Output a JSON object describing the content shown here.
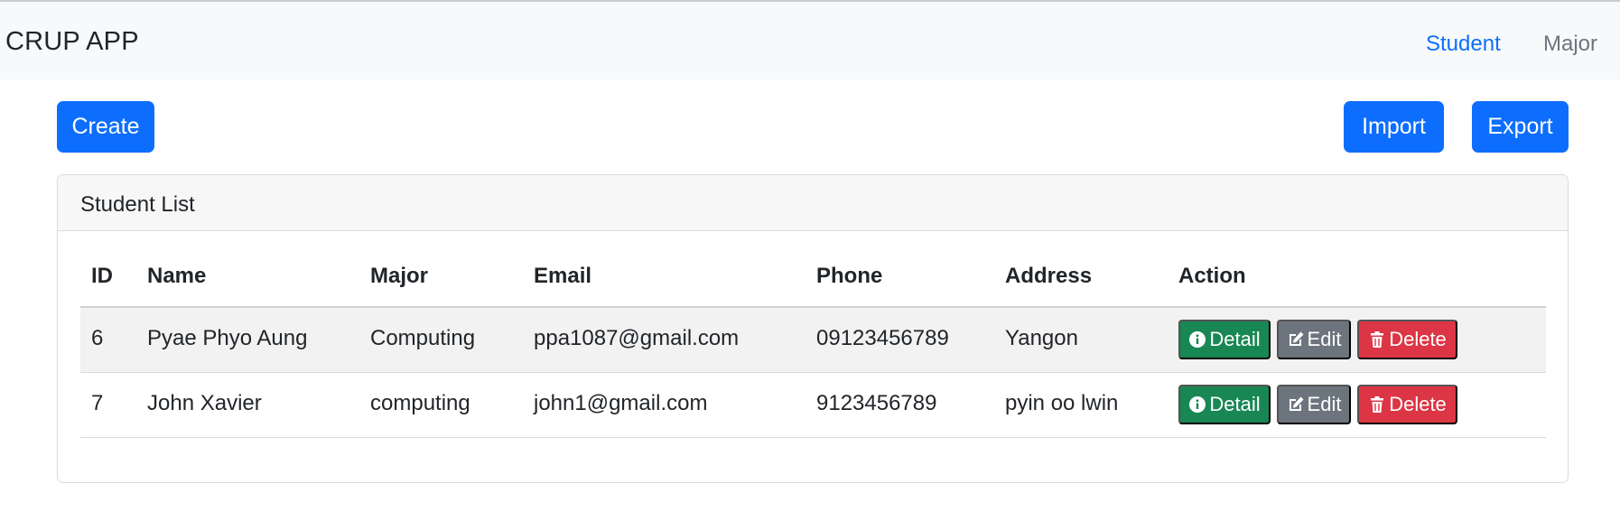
{
  "navbar": {
    "brand": "CRUP APP",
    "links": [
      {
        "label": "Student",
        "active": true
      },
      {
        "label": "Major",
        "active": false
      }
    ]
  },
  "toolbar": {
    "create_label": "Create",
    "import_label": "Import",
    "export_label": "Export"
  },
  "card": {
    "title": "Student List"
  },
  "table": {
    "headers": [
      "ID",
      "Name",
      "Major",
      "Email",
      "Phone",
      "Address",
      "Action"
    ],
    "rows": [
      {
        "id": "6",
        "name": "Pyae Phyo Aung",
        "major": "Computing",
        "email": "ppa1087@gmail.com",
        "phone": "09123456789",
        "address": "Yangon"
      },
      {
        "id": "7",
        "name": "John Xavier",
        "major": "computing",
        "email": "john1@gmail.com",
        "phone": "9123456789",
        "address": "pyin oo lwin"
      }
    ],
    "actions": {
      "detail_label": "Detail",
      "edit_label": "Edit",
      "delete_label": "Delete"
    }
  },
  "colors": {
    "primary": "#0d6efd",
    "success": "#198754",
    "secondary": "#6c757d",
    "danger": "#dc3545"
  },
  "icons": {
    "detail": "info-circle-icon",
    "edit": "pencil-square-icon",
    "delete": "trash-icon"
  }
}
